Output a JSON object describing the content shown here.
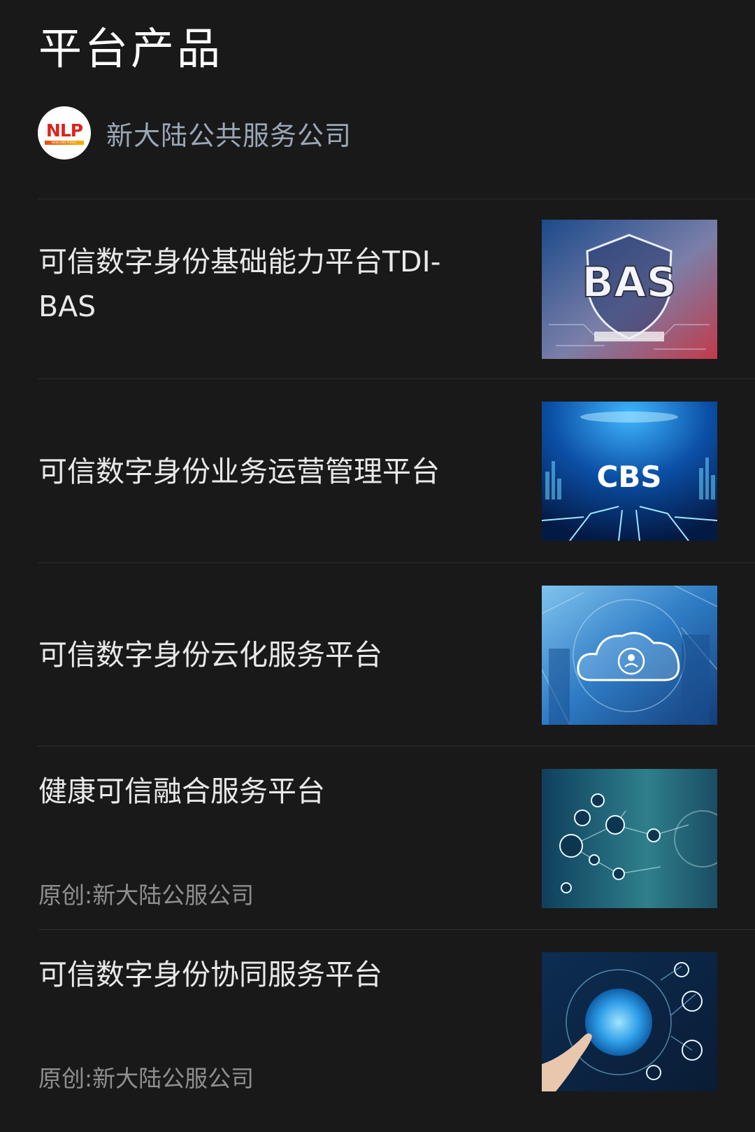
{
  "header": {
    "title": "平台产品"
  },
  "publisher": {
    "name": "新大陆公共服务公司",
    "logo_text": "NLP",
    "logo_strip": "NEWLAND PUBLIC"
  },
  "articles": [
    {
      "title": "可信数字身份基础能力平台TDI-BAS",
      "meta": "",
      "thumb_text": "BAS",
      "thumb_icon": "shield-circuit-icon"
    },
    {
      "title": "可信数字身份业务运营管理平台",
      "meta": "",
      "thumb_text": "CBS",
      "thumb_icon": "city-circuit-icon"
    },
    {
      "title": "可信数字身份云化服务平台",
      "meta": "",
      "thumb_text": "",
      "thumb_icon": "cloud-user-icon"
    },
    {
      "title": "健康可信融合服务平台",
      "meta": "原创:新大陆公服公司",
      "thumb_text": "",
      "thumb_icon": "network-nodes-icon"
    },
    {
      "title": "可信数字身份协同服务平台",
      "meta": "原创:新大陆公服公司",
      "thumb_text": "",
      "thumb_icon": "globe-touch-icon"
    }
  ],
  "colors": {
    "background": "#191919",
    "title": "#ffffff",
    "publisher": "#9aa7b8",
    "meta": "#8f8f8f"
  }
}
